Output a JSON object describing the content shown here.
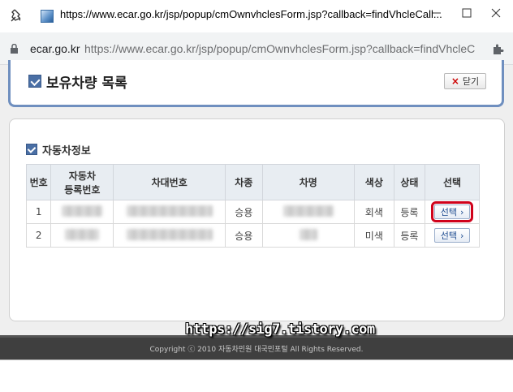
{
  "window": {
    "title": "https://www.ecar.go.kr/jsp/popup/cmOwnvhclesForm.jsp?callback=findVhcleCall..."
  },
  "addressbar": {
    "host": "ecar.go.kr",
    "url": "https://www.ecar.go.kr/jsp/popup/cmOwnvhclesForm.jsp?callback=findVhcleC"
  },
  "header": {
    "title": "보유차량 목록",
    "close_label": "닫기",
    "close_icon": "×"
  },
  "section": {
    "title": "자동차정보"
  },
  "table": {
    "headers": {
      "no": "번호",
      "reg_no_line1": "자동차",
      "reg_no_line2": "등록번호",
      "vin": "차대번호",
      "type": "차종",
      "name": "차명",
      "color": "색상",
      "status": "상태",
      "select": "선택"
    },
    "rows": [
      {
        "no": "1",
        "type": "승용",
        "color": "회색",
        "status": "등록",
        "select": "선택",
        "select_arrow": "›"
      },
      {
        "no": "2",
        "type": "승용",
        "color": "미색",
        "status": "등록",
        "select": "선택",
        "select_arrow": "›"
      }
    ]
  },
  "footer": {
    "copyright": "Copyright ⓒ 2010 자동차민원 대국민포털  All Rights Reserved."
  },
  "watermark": "https://sig7.tistory.com",
  "colors": {
    "header_border": "#6f8fbf",
    "footer_bg": "#3f3f3f",
    "highlight": "#d0021b"
  }
}
